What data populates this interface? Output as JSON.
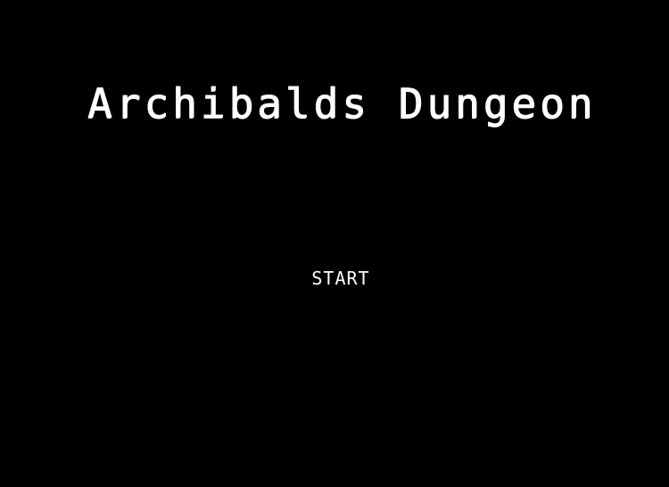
{
  "game": {
    "title": "Archibalds Dungeon",
    "start_label": "START"
  },
  "colors": {
    "background": "#000000",
    "text": "#ffffff"
  }
}
